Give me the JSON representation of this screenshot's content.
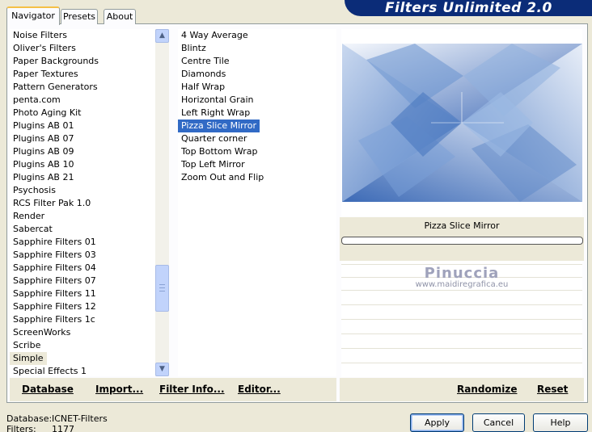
{
  "header": {
    "title": "Filters Unlimited 2.0"
  },
  "tabs": [
    {
      "label": "Navigator",
      "active": true
    },
    {
      "label": "Presets",
      "active": false
    },
    {
      "label": "About",
      "active": false
    }
  ],
  "categories": {
    "items": [
      "Noise Filters",
      "Oliver's Filters",
      "Paper Backgrounds",
      "Paper Textures",
      "Pattern Generators",
      "penta.com",
      "Photo Aging Kit",
      "Plugins AB 01",
      "Plugins AB 07",
      "Plugins AB 09",
      "Plugins AB 10",
      "Plugins AB 21",
      "Psychosis",
      "RCS Filter Pak 1.0",
      "Render",
      "Sabercat",
      "Sapphire Filters 01",
      "Sapphire Filters 03",
      "Sapphire Filters 04",
      "Sapphire Filters 07",
      "Sapphire Filters 11",
      "Sapphire Filters 12",
      "Sapphire Filters 1c",
      "ScreenWorks",
      "Scribe",
      "Simple",
      "Special Effects 1"
    ],
    "selected": "Simple",
    "scrollbar": {
      "thumb_position": 0.72
    }
  },
  "filters": {
    "items": [
      "4 Way Average",
      "Blintz",
      "Centre Tile",
      "Diamonds",
      "Half Wrap",
      "Horizontal Grain",
      "Left Right Wrap",
      "Pizza Slice Mirror",
      "Quarter corner",
      "Top Bottom Wrap",
      "Top Left Mirror",
      "Zoom Out and Flip"
    ],
    "selected": "Pizza Slice Mirror"
  },
  "left_buttons": {
    "database": "Database",
    "import": "Import...",
    "filter_info": "Filter Info...",
    "editor": "Editor..."
  },
  "preview": {
    "filter_name": "Pizza Slice Mirror"
  },
  "watermark": {
    "title": "Pinuccia",
    "url": "www.maidiregrafica.eu"
  },
  "right_buttons": {
    "randomize": "Randomize",
    "reset": "Reset"
  },
  "status": {
    "database_label": "Database:",
    "database_value": "ICNET-Filters",
    "filters_label": "Filters:",
    "filters_value": "1177"
  },
  "dialog_buttons": {
    "apply": "Apply",
    "cancel": "Cancel",
    "help": "Help"
  },
  "colors": {
    "banner": "#0b2c78",
    "selection": "#316ac5",
    "preview_blue": "#4a78c0",
    "tab_highlight": "#f5c046"
  }
}
